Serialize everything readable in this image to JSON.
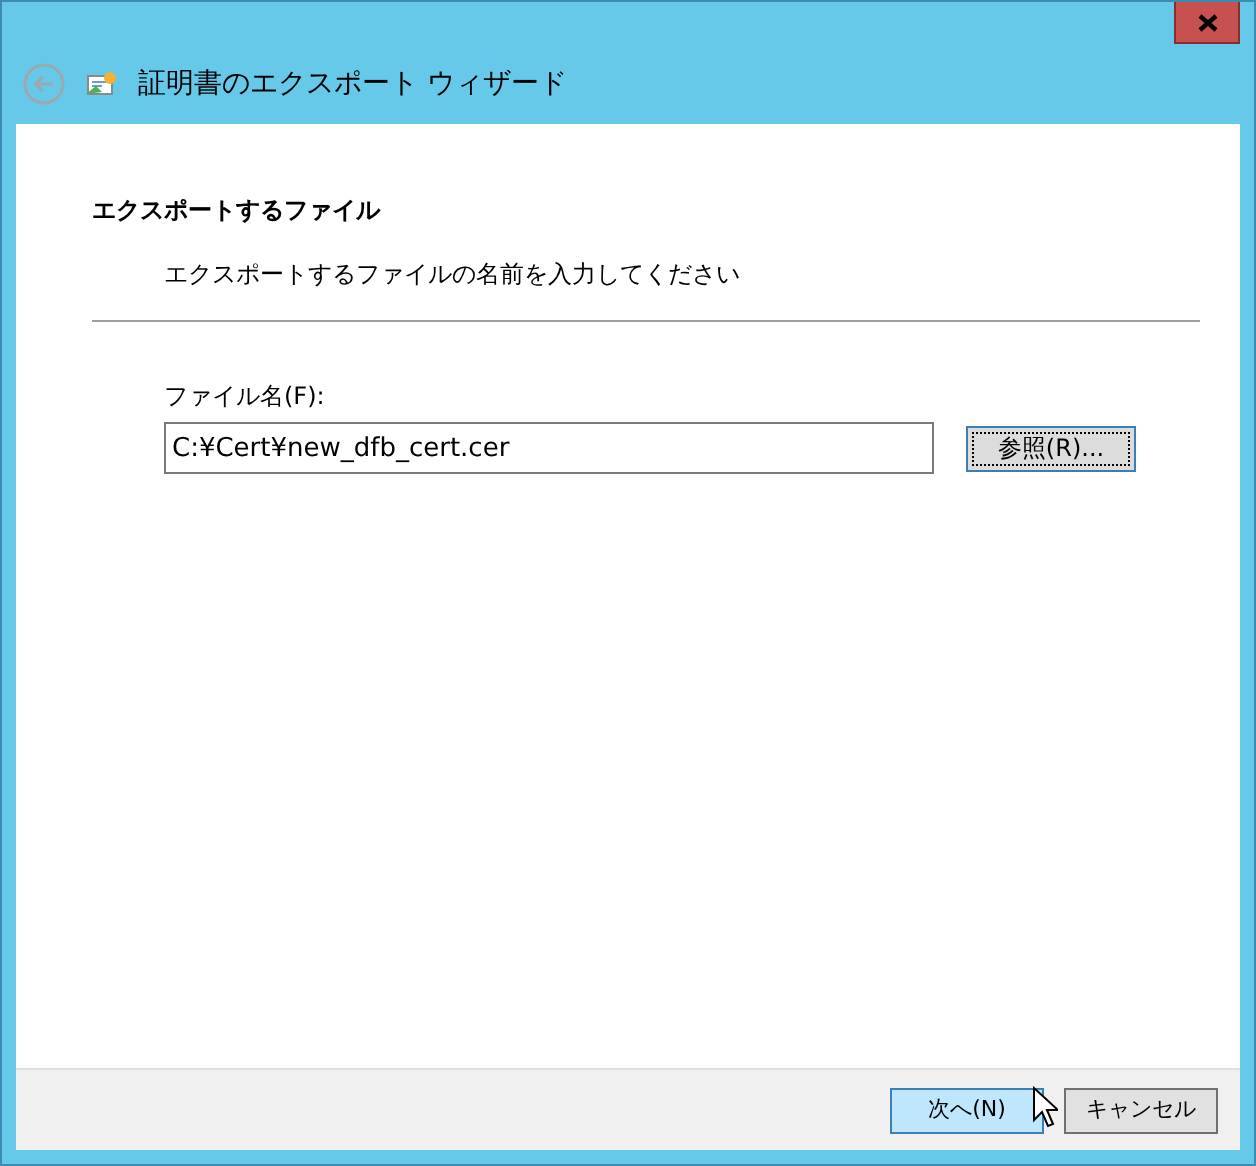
{
  "window": {
    "title": "証明書のエクスポート ウィザード"
  },
  "page": {
    "heading": "エクスポートするファイル",
    "description": "エクスポートするファイルの名前を入力してください"
  },
  "file_field": {
    "label": "ファイル名(F):",
    "value": "C:¥Cert¥new_dfb_cert.cer",
    "browse_button": "参照(R)..."
  },
  "buttons": [
    {
      "label": "次へ(N)",
      "default": true
    },
    {
      "label": "キャンセル",
      "default": false
    }
  ]
}
